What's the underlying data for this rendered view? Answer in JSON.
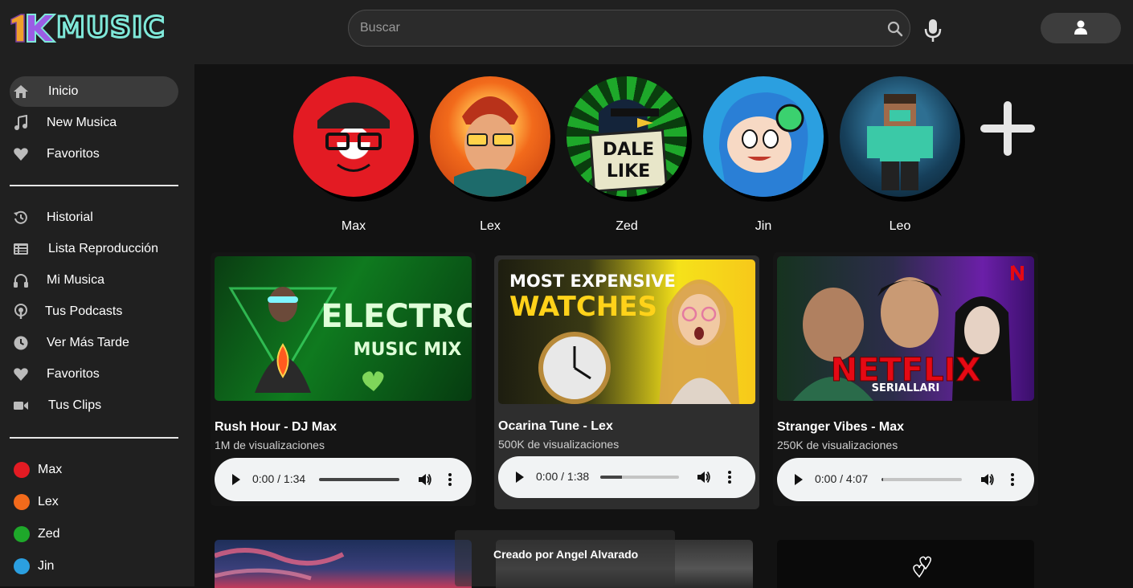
{
  "brand": {
    "logo_text": "MUSIC"
  },
  "search": {
    "placeholder": "Buscar"
  },
  "sidebar": {
    "main": [
      {
        "label": "Inicio",
        "icon": "home-icon",
        "active": true
      },
      {
        "label": "New Musica",
        "icon": "music-note-icon"
      },
      {
        "label": "Favoritos",
        "icon": "heart-icon"
      }
    ],
    "library": [
      {
        "label": "Historial",
        "icon": "history-icon"
      },
      {
        "label": "Lista Reproducción",
        "icon": "list-icon"
      },
      {
        "label": "Mi Musica",
        "icon": "headphones-icon"
      },
      {
        "label": "Tus Podcasts",
        "icon": "podcast-icon"
      },
      {
        "label": "Ver Más Tarde",
        "icon": "clock-icon"
      },
      {
        "label": "Favoritos",
        "icon": "heart-icon"
      },
      {
        "label": "Tus Clips",
        "icon": "video-camera-icon"
      }
    ],
    "subscriptions": [
      {
        "label": "Max"
      },
      {
        "label": "Lex"
      },
      {
        "label": "Zed"
      },
      {
        "label": "Jin"
      }
    ]
  },
  "creators": [
    {
      "name": "Max",
      "color": "#e31b23"
    },
    {
      "name": "Lex",
      "color": "#f26a1b"
    },
    {
      "name": "Zed",
      "color": "#1ea82a"
    },
    {
      "name": "Jin",
      "color": "#2b9fe0"
    },
    {
      "name": "Leo",
      "color": "#163f5a"
    }
  ],
  "videos": [
    {
      "title": "Rush Hour - DJ Max",
      "views": "1M de visualizaciones",
      "time": "0:00 / 1:34",
      "progress": 1.0,
      "thumb_text": [
        "ELECTRO",
        "MUSIC MIX"
      ]
    },
    {
      "title": "Ocarina Tune - Lex",
      "views": "500K de visualizaciones",
      "time": "0:00 / 1:38",
      "progress": 0.28,
      "thumb_text": [
        "MOST EXPENSIVE",
        "WATCHES"
      ]
    },
    {
      "title": "Stranger Vibes - Max",
      "views": "250K de visualizaciones",
      "time": "0:00 / 4:07",
      "progress": 0.02,
      "thumb_text": [
        "NETFLIX",
        "SERIALLARI"
      ]
    }
  ],
  "tooltip": {
    "text": "Creado por Angel Alvarado"
  },
  "colors": {
    "accent": "#7fe8d9",
    "header_bg": "#202020",
    "page_bg": "#121212"
  }
}
